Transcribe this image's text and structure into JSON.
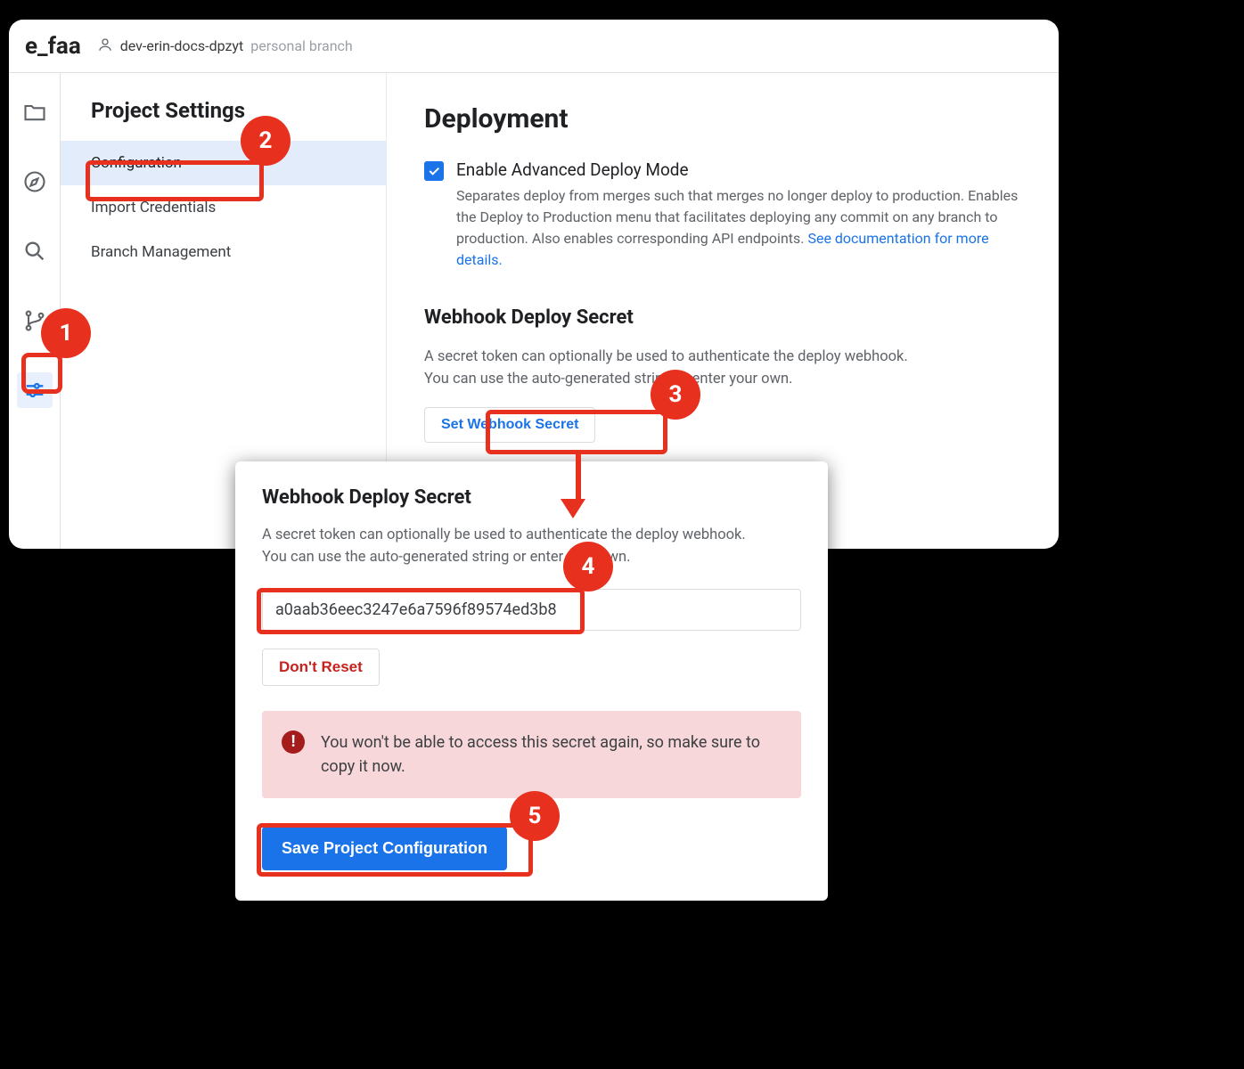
{
  "header": {
    "brand": "e_faa",
    "branch_name": "dev-erin-docs-dpzyt",
    "branch_type": "personal branch"
  },
  "sidebar": {
    "title": "Project Settings",
    "items": [
      {
        "label": "Configuration",
        "selected": true
      },
      {
        "label": "Import Credentials",
        "selected": false
      },
      {
        "label": "Branch Management",
        "selected": false
      }
    ]
  },
  "content": {
    "title": "Deployment",
    "checkbox_label": "Enable Advanced Deploy Mode",
    "checkbox_desc": "Separates deploy from merges such that merges no longer deploy to production. Enables the Deploy to Production menu that facilitates deploying any commit on any branch to production. Also enables corresponding API endpoints. ",
    "checkbox_link": "See documentation for more details.",
    "webhook_title": "Webhook Deploy Secret",
    "webhook_desc_line1": "A secret token can optionally be used to authenticate the deploy webhook.",
    "webhook_desc_line2": "You can use the auto-generated string or enter your own.",
    "set_webhook_button": "Set Webhook Secret"
  },
  "modal": {
    "title": "Webhook Deploy Secret",
    "desc_line1": "A secret token can optionally be used to authenticate the deploy webhook.",
    "desc_line2": "You can use the auto-generated string or enter your own.",
    "secret_value": "a0aab36eec3247e6a7596f89574ed3b8",
    "dont_reset": "Don't Reset",
    "warning_text": "You won't be able to access this secret again, so make sure to copy it now.",
    "save_button": "Save Project Configuration"
  },
  "callouts": {
    "1": "1",
    "2": "2",
    "3": "3",
    "4": "4",
    "5": "5"
  }
}
